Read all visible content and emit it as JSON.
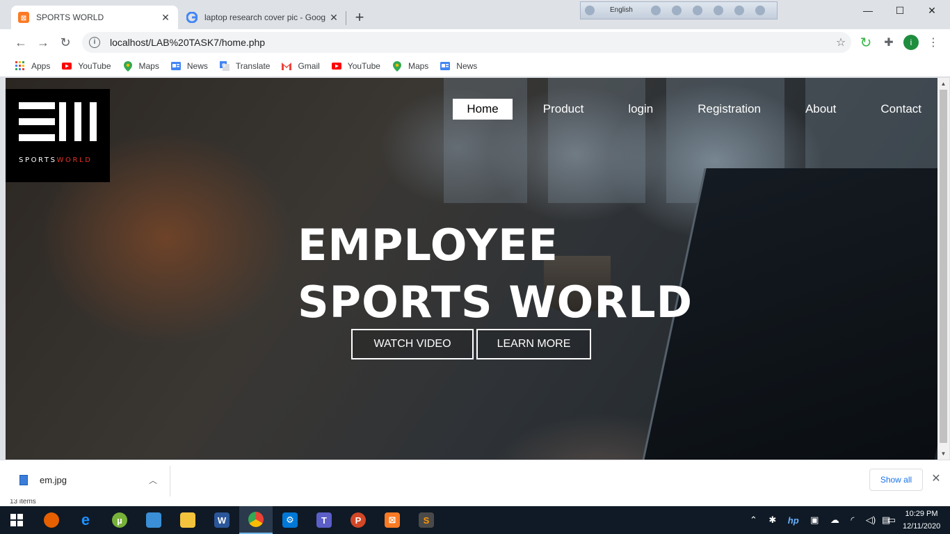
{
  "browser": {
    "tabs": [
      {
        "title": "SPORTS WORLD",
        "active": true
      },
      {
        "title": "laptop research cover pic - Goog",
        "active": false
      }
    ],
    "new_tab_symbol": "+",
    "language_bar": {
      "language": "English"
    },
    "address": "localhost/LAB%20TASK7/home.php",
    "profile_initial": "i",
    "bookmarks": [
      {
        "label": "Apps",
        "icon": "apps-grid-icon"
      },
      {
        "label": "YouTube",
        "icon": "youtube-icon"
      },
      {
        "label": "Maps",
        "icon": "maps-icon"
      },
      {
        "label": "News",
        "icon": "news-icon"
      },
      {
        "label": "Translate",
        "icon": "translate-icon"
      },
      {
        "label": "Gmail",
        "icon": "gmail-icon"
      },
      {
        "label": "YouTube",
        "icon": "youtube-icon"
      },
      {
        "label": "Maps",
        "icon": "maps-icon"
      },
      {
        "label": "News",
        "icon": "news-icon"
      }
    ]
  },
  "site": {
    "logo": {
      "text_white": "SPORTS",
      "text_red": "WORLD"
    },
    "nav": [
      {
        "label": "Home",
        "active": true
      },
      {
        "label": "Product",
        "active": false
      },
      {
        "label": "login",
        "active": false
      },
      {
        "label": "Registration",
        "active": false
      },
      {
        "label": "About",
        "active": false
      },
      {
        "label": "Contact",
        "active": false
      }
    ],
    "hero": {
      "line1": "EMPLOYEE",
      "line2": "SPORTS WORLD",
      "watch_video": "WATCH VIDEO",
      "learn_more": "LEARN MORE"
    }
  },
  "downloads": {
    "file_name": "em.jpg",
    "show_all": "Show all"
  },
  "behind_text": "13 items",
  "taskbar": {
    "time": "10:29 PM",
    "date": "12/11/2020"
  },
  "colors": {
    "accent_red": "#e2322a",
    "link_blue": "#1a73e8",
    "taskbar_bg": "#0f1a26"
  }
}
